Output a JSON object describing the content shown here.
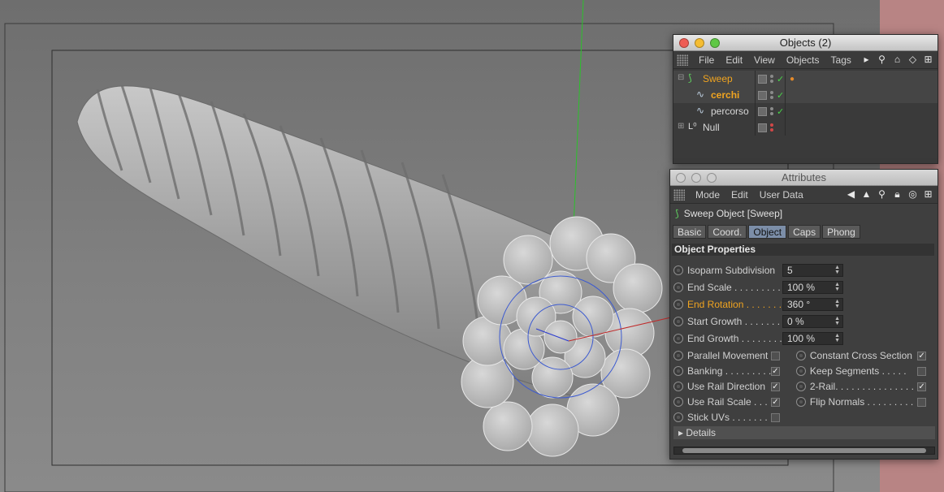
{
  "colors": {
    "accent_orange": "#f0a420",
    "check_green": "#49d449",
    "tab_active": "#7c8ea8",
    "red_strip": "#b88484"
  },
  "objects_panel": {
    "title": "Objects (2)",
    "menu": [
      "File",
      "Edit",
      "View",
      "Objects",
      "Tags"
    ],
    "toolbar_icons": [
      "arrow-right-icon",
      "search-icon",
      "home-icon",
      "eye-icon",
      "add-icon"
    ],
    "items": [
      {
        "name": "Sweep",
        "icon": "sweep-icon",
        "highlight": true
      },
      {
        "name": "cerchi",
        "icon": "spline-icon",
        "highlight": true
      },
      {
        "name": "percorso",
        "icon": "spline-icon",
        "highlight": false
      },
      {
        "name": "Null",
        "icon": "null-icon",
        "highlight": false
      }
    ]
  },
  "attributes_panel": {
    "title": "Attributes",
    "menu": [
      "Mode",
      "Edit",
      "User Data"
    ],
    "object_header": "Sweep Object [Sweep]",
    "tabs": [
      "Basic",
      "Coord.",
      "Object",
      "Caps",
      "Phong"
    ],
    "active_tab": "Object",
    "section_title": "Object Properties",
    "fields": [
      {
        "label": "Isoparm Subdivision",
        "value": "5"
      },
      {
        "label": "End Scale . . . . . . . . . .",
        "value": "100 %"
      },
      {
        "label": "End Rotation . . . . . . .",
        "value": "360 °"
      },
      {
        "label": "Start Growth . . . . . . .",
        "value": "0 %"
      },
      {
        "label": "End Growth . . . . . . . .",
        "value": "100 %"
      }
    ],
    "checks_left": [
      {
        "label": "Parallel Movement",
        "checked": false
      },
      {
        "label": "Banking . . . . . . . . .",
        "checked": true
      },
      {
        "label": "Use Rail Direction",
        "checked": true
      },
      {
        "label": "Use Rail Scale . . . .",
        "checked": true
      },
      {
        "label": "Stick UVs . . . . . . . .",
        "checked": false
      }
    ],
    "checks_right": [
      {
        "label": "Constant Cross Section",
        "checked": true
      },
      {
        "label": "Keep Segments . . . . .",
        "checked": false
      },
      {
        "label": "2-Rail. . . . . . . . . . . . . . .",
        "checked": true
      },
      {
        "label": "Flip Normals . . . . . . . . .",
        "checked": false
      }
    ],
    "details_label": "Details",
    "check_mark": "✓"
  }
}
